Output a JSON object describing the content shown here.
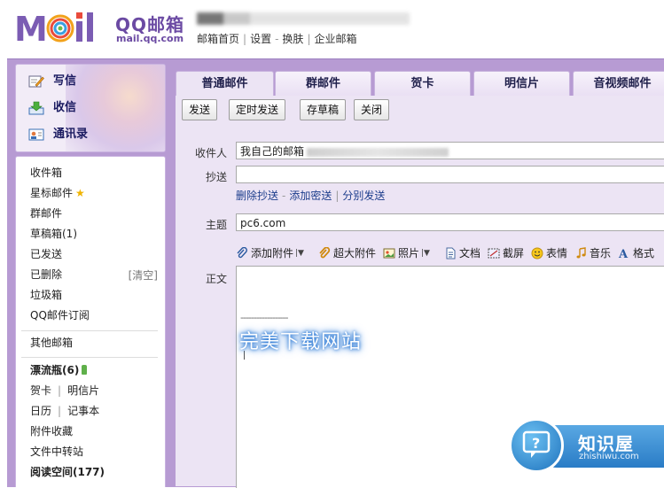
{
  "header": {
    "logo_cn": "QQ邮箱",
    "logo_en": "mail.qq.com",
    "links": [
      "邮箱首页",
      "设置",
      "换肤",
      "企业邮箱"
    ],
    "link_seps": [
      "|",
      "-",
      "|"
    ]
  },
  "quick_actions": [
    {
      "label": "写信",
      "icon": "pencil-icon"
    },
    {
      "label": "收信",
      "icon": "inbox-download-icon"
    },
    {
      "label": "通讯录",
      "icon": "contact-card-icon"
    }
  ],
  "folders": {
    "inbox": "收件箱",
    "starred": "星标邮件",
    "group": "群邮件",
    "drafts": "草稿箱(1)",
    "sent": "已发送",
    "deleted": "已删除",
    "clear": "[清空]",
    "spam": "垃圾箱",
    "subscriptions": "QQ邮件订阅",
    "other": "其他邮箱",
    "bottle": "漂流瓶(6)",
    "card": "贺卡",
    "postcard": "明信片",
    "calendar": "日历",
    "notes": "记事本",
    "attach_fav": "附件收藏",
    "transfer": "文件中转站",
    "reading": "阅读空间(177)",
    "sep": "|"
  },
  "tabs": [
    "普通邮件",
    "群邮件",
    "贺卡",
    "明信片",
    "音视频邮件"
  ],
  "toolbar": {
    "send": "发送",
    "schedule": "定时发送",
    "save": "存草稿",
    "close": "关闭"
  },
  "form": {
    "to_label": "收件人",
    "to_value": "我自己的邮箱",
    "cc_label": "抄送",
    "cc_links": [
      "删除抄送",
      "添加密送",
      "分别发送"
    ],
    "cc_seps": [
      "-",
      "|"
    ],
    "subject_label": "主题",
    "subject_value": "pc6.com",
    "body_label": "正文",
    "signature_line": "------------------"
  },
  "attach_bar": [
    {
      "label": "添加附件",
      "icon": "paperclip-icon",
      "dropdown": true
    },
    {
      "label": "超大附件",
      "icon": "big-paperclip-icon",
      "dropdown": false
    },
    {
      "label": "照片",
      "icon": "photo-icon",
      "dropdown": true
    },
    {
      "label": "文档",
      "icon": "document-icon",
      "dropdown": false
    },
    {
      "label": "截屏",
      "icon": "screenshot-icon",
      "dropdown": false
    },
    {
      "label": "表情",
      "icon": "smiley-icon",
      "dropdown": false
    },
    {
      "label": "音乐",
      "icon": "music-note-icon",
      "dropdown": false
    },
    {
      "label": "格式",
      "icon": "format-a-icon",
      "dropdown": false
    }
  ],
  "watermark": "完美下载网站",
  "badge": {
    "title": "知识屋",
    "subtitle": "zhishiwu.com"
  },
  "colors": {
    "frame_purple": "#b79bd3",
    "panel_lilac": "#ece4f4",
    "link_blue": "#1c3d8c",
    "logo_purple": "#6b4aa3"
  }
}
